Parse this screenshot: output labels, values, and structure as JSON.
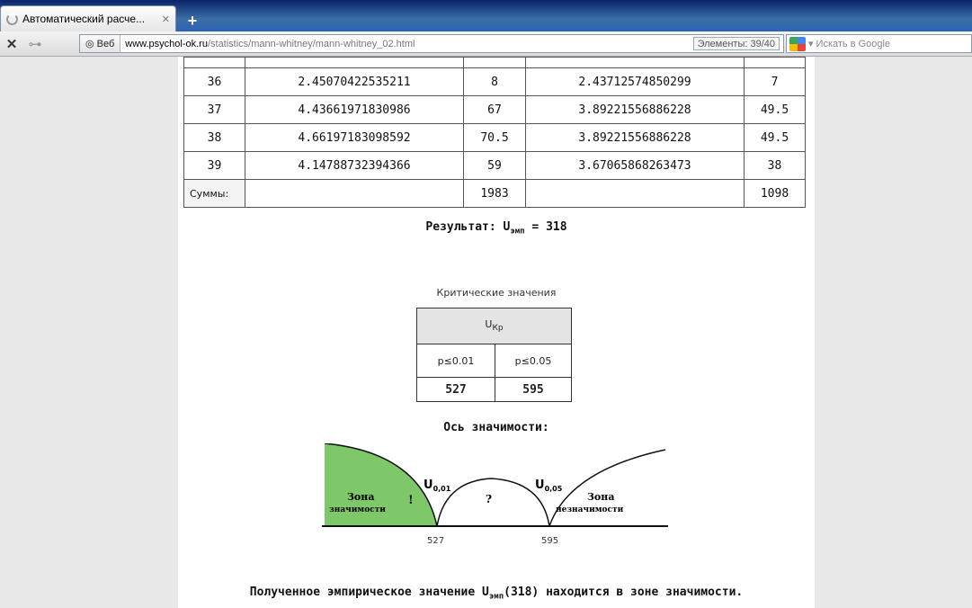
{
  "browser": {
    "tab_title": "Автоматический расче...",
    "tab_close": "✕",
    "new_tab": "+",
    "web_button": "Веб",
    "url_host": "www.psychol-ok.ru",
    "url_path": "/statistics/mann-whitney/mann-whitney_02.html",
    "elements_label": "Элементы: 39/40",
    "search_placeholder": "Искать в Google"
  },
  "table": {
    "rows": [
      {
        "n": "36",
        "v1": "2.45070422535211",
        "r1": "8",
        "v2": "2.43712574850299",
        "r2": "7"
      },
      {
        "n": "37",
        "v1": "4.43661971830986",
        "r1": "67",
        "v2": "3.89221556886228",
        "r2": "49.5"
      },
      {
        "n": "38",
        "v1": "4.66197183098592",
        "r1": "70.5",
        "v2": "3.89221556886228",
        "r2": "49.5"
      },
      {
        "n": "39",
        "v1": "4.14788732394366",
        "r1": "59",
        "v2": "3.67065868263473",
        "r2": "38"
      }
    ],
    "sums_label": "Суммы:",
    "sum_r1": "1983",
    "sum_r2": "1098"
  },
  "result": {
    "prefix": "Результат: U",
    "sub": "эмп",
    "suffix": " = 318"
  },
  "critical": {
    "caption": "Критические значения",
    "header": "U",
    "header_sub": "Кр",
    "p1": "p≤0.01",
    "p2": "p≤0.05",
    "v1": "527",
    "v2": "595"
  },
  "axis": {
    "title": "Ось значимости:",
    "zone_sig_1": "Зона",
    "zone_sig_2": "значимости",
    "zone_nonsig_1": "Зона",
    "zone_nonsig_2": "незначимости",
    "u1": "U",
    "u1_sub": "0,01",
    "u2": "U",
    "u2_sub": "0,05",
    "excl": "!",
    "question": "?",
    "tick1": "527",
    "tick2": "595"
  },
  "conclusion": {
    "prefix": "Полученное эмпирическое значение U",
    "sub": "эмп",
    "suffix": "(318) находится в зоне значимости."
  },
  "colors": {
    "sig_zone": "#7fc86a"
  }
}
